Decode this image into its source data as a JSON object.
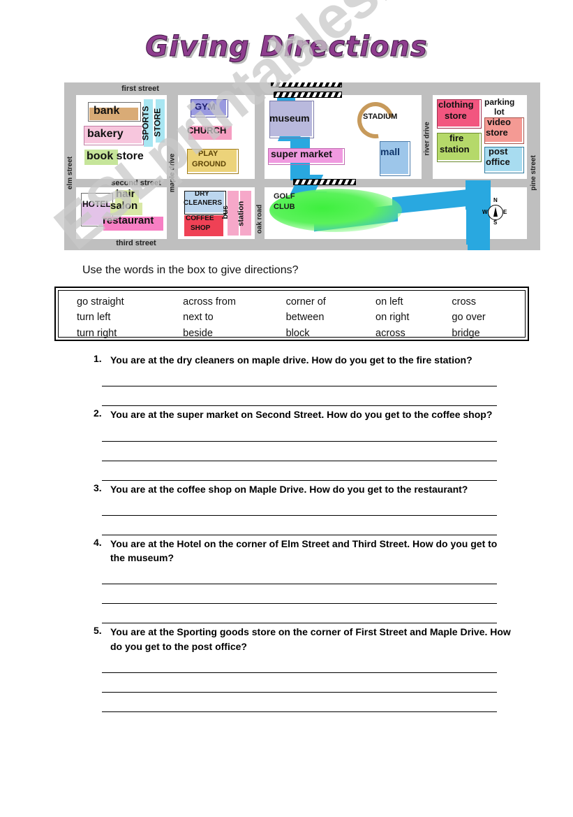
{
  "title": "Giving Directions",
  "instruction": "Use the words in the box to give directions?",
  "watermark": "ESLprintables.com",
  "map": {
    "streets": {
      "first": "first street",
      "second": "second street",
      "third": "third street",
      "elm": "elm street",
      "maple": "maple drive",
      "oak": "oak road",
      "river": "river drive",
      "pine": "pine street"
    },
    "compass": {
      "n": "N",
      "s": "S",
      "e": "E",
      "w": "W"
    },
    "places": [
      {
        "name": "bank",
        "color": "#d9ab76"
      },
      {
        "name": "bakery",
        "color": "#f7c6dd"
      },
      {
        "name": "book store",
        "color": "#c6e59a"
      },
      {
        "name": "SPORTS",
        "color": "#a8e6f2"
      },
      {
        "name": "STORE",
        "color": "#a8e6f2"
      },
      {
        "name": "GYM",
        "color": "#9a9ae0"
      },
      {
        "name": "CHURCH",
        "color": "#f59ec1"
      },
      {
        "name": "PLAY",
        "color": "#ecd37a"
      },
      {
        "name": "GROUND",
        "color": "#ecd37a"
      },
      {
        "name": "museum",
        "color": "#b9b9dd"
      },
      {
        "name": "super market",
        "color": "#f09ae0"
      },
      {
        "name": "STADIUM",
        "color": "#c79a5b"
      },
      {
        "name": "mall",
        "color": "#9dc6ea"
      },
      {
        "name": "clothing store",
        "color": "#f2567f"
      },
      {
        "name": "parking lot",
        "color": "#ffffff"
      },
      {
        "name": "fire station",
        "color": "#b5d96a"
      },
      {
        "name": "video store",
        "color": "#f49a94"
      },
      {
        "name": "post office",
        "color": "#a8dcf0"
      },
      {
        "name": "HOTEL",
        "color": "#e3c3e8"
      },
      {
        "name": "hair salon",
        "color": "#d9e8a6"
      },
      {
        "name": "restaurant",
        "color": "#f77fc4"
      },
      {
        "name": "DRY CLEANERS",
        "color": "#bcd6ee"
      },
      {
        "name": "COFFEE SHOP",
        "color": "#ef4155"
      },
      {
        "name": "bus station",
        "color": "#f6a8c9"
      },
      {
        "name": "GOLF CLUB",
        "color": "#4df04d"
      }
    ],
    "labels": {
      "bank": "bank",
      "bakery": "bakery",
      "book_store": "book store",
      "sports": "SPORTS",
      "store": "STORE",
      "gym": "GYM",
      "church": "CHURCH",
      "play": "PLAY",
      "ground": "GROUND",
      "museum": "museum",
      "super_market": "super market",
      "stadium": "STADIUM",
      "mall": "mall",
      "clothing": "clothing",
      "clothing_store": "store",
      "parking": "parking",
      "lot": "lot",
      "fire": "fire",
      "station": "station",
      "video": "video",
      "video_store": "store",
      "post": "post",
      "office": "office",
      "hotel": "HOTEL",
      "hair": "hair",
      "salon": "salon",
      "restaurant": "restaurant",
      "dry": "DRY",
      "cleaners": "CLEANERS",
      "coffee": "COFFEE",
      "shop": "SHOP",
      "bus": "bus",
      "bus_station": "station",
      "golf": "GOLF",
      "club": "CLUB"
    }
  },
  "wordbox": {
    "columns": [
      [
        "go straight",
        "turn left",
        "turn right"
      ],
      [
        "across from",
        "next to",
        "beside"
      ],
      [
        "corner of",
        "between",
        "block"
      ],
      [
        "on left",
        "on right",
        "across"
      ],
      [
        "cross",
        "go over",
        "bridge"
      ]
    ]
  },
  "questions": [
    {
      "number": "1.",
      "text": "You are at the dry cleaners on maple drive.  How do you get to the fire station?",
      "answer_lines": 2
    },
    {
      "number": "2.",
      "text": "You are at the super market on Second Street.  How do you get to the coffee shop?",
      "answer_lines": 3
    },
    {
      "number": "3.",
      "text": "You are at the coffee shop on Maple Drive.  How do you get to the restaurant?",
      "answer_lines": 2
    },
    {
      "number": "4.",
      "text": "You are at the Hotel on the corner of Elm Street and Third Street.  How do you get to the museum?",
      "answer_lines": 3
    },
    {
      "number": "5.",
      "text": "You are at the Sporting goods store on the corner of First Street and Maple Drive.  How do you get to the post office?",
      "answer_lines": 3
    }
  ]
}
